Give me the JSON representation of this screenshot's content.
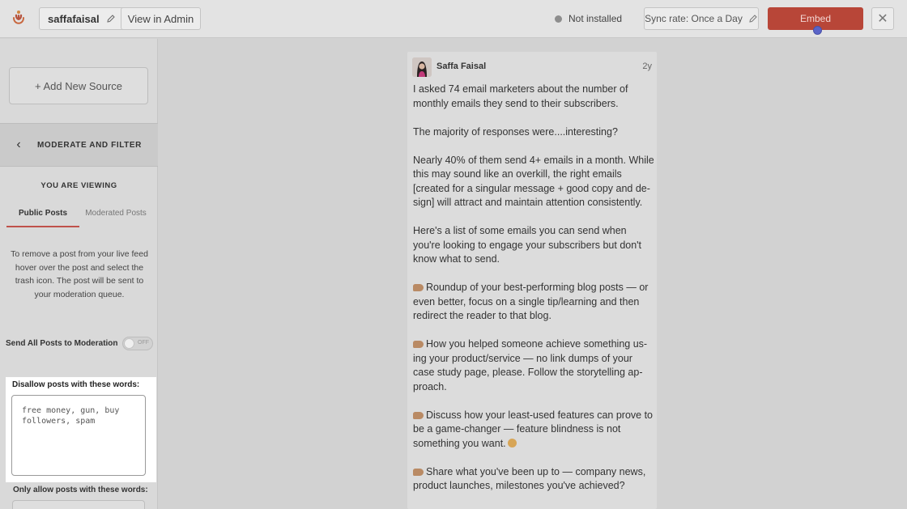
{
  "header": {
    "name_pill_label": "saffafaisal",
    "view_admin_label": "View in Admin",
    "status_text": "Not installed",
    "sync_label": "Sync rate: Once a Day",
    "embed_label": "Embed",
    "close_glyph": "✕"
  },
  "sidebar": {
    "add_source_label": "+ Add New Source",
    "back_glyph": "‹",
    "section_title": "MODERATE AND FILTER",
    "viewing_label": "YOU ARE VIEWING",
    "tabs": [
      {
        "label": "Public Posts",
        "active": true
      },
      {
        "label": "Moderated Posts",
        "active": false
      }
    ],
    "help_text": "To remove a post from your live feed hover over the post and select the trash icon. The post will be sent to your moderation queue.",
    "send_all_label": "Send All Posts to Moderation",
    "toggle_text": "OFF",
    "disallow_label": "Disallow posts with these words:",
    "disallow_value": "free money, gun, buy\nfollowers, spam",
    "allow_label": "Only allow posts with these words:"
  },
  "post": {
    "author": "Saffa Faisal",
    "age": "2y",
    "paragraphs": [
      {
        "text": "I asked 74 email marketers about the number of monthly emails they send to their subscribers."
      },
      {
        "text": "The majority of responses were....interesting?"
      },
      {
        "text": "Nearly 40% of them send 4+ emails in a month. While this may sound like an overkill, the right emails [created for a singular message + good copy and de- sign] will attract and maintain attention consistently."
      },
      {
        "text": "Here's a list of some emails you can send when you're looking to engage your subscribers but don't know what to send."
      },
      {
        "text": "Roundup of your best-performing blog posts — or even better, focus on a single tip/learning and then redirect the reader to that blog."
      },
      {
        "text": "How you helped someone achieve something us- ing your product/service — no link dumps of your case study page, please. Follow the storytelling ap- proach."
      },
      {
        "text": "Discuss how your least-used features can prove to be a game-changer — feature blindness is not something you want."
      },
      {
        "text": "Share what you've been up to — company news, product launches, milestones you've achieved?"
      }
    ]
  },
  "colors": {
    "embed_button": "#b84638",
    "active_tab_underline": "#c0524b",
    "cursor_dot": "#5a64c8"
  }
}
